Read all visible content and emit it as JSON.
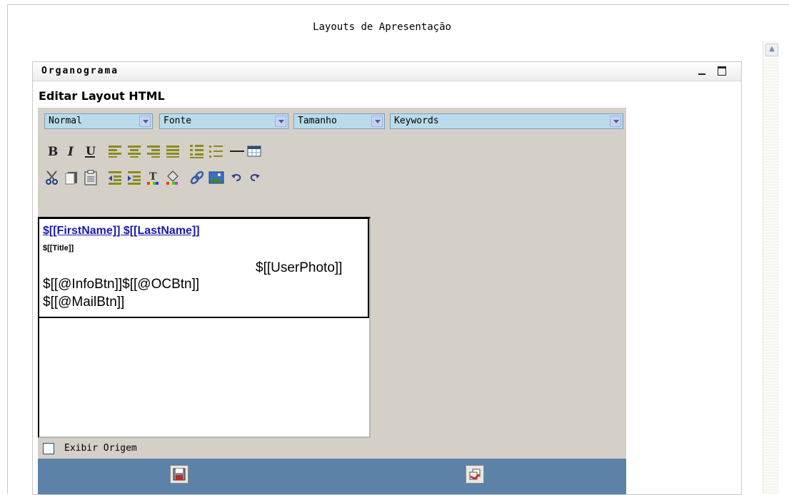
{
  "page": {
    "heading": "Layouts de Apresentação"
  },
  "portlet": {
    "title": "Organograma"
  },
  "editor": {
    "heading": "Editar Layout HTML",
    "selects": {
      "format": "Normal",
      "font": "Fonte",
      "size": "Tamanho",
      "keywords": "Keywords"
    },
    "toolbar_row1": [
      "bold-icon",
      "italic-icon",
      "underline-icon",
      "align-left-icon",
      "align-center-icon",
      "align-right-icon",
      "justify-icon",
      "ordered-list-icon",
      "unordered-list-icon",
      "horizontal-rule-icon",
      "table-icon"
    ],
    "toolbar_row2": [
      "cut-icon",
      "copy-icon",
      "paste-icon",
      "outdent-icon",
      "indent-icon",
      "text-color-icon",
      "background-color-icon",
      "link-icon",
      "image-icon",
      "undo-icon",
      "redo-icon"
    ],
    "canvas": {
      "name_line": "$[[FirstName]] $[[LastName]]",
      "title_line": "$[[Title]]",
      "photo_line": "$[[UserPhoto]]",
      "buttons_line": "$[[@InfoBtn]]$[[@OCBtn]]",
      "mail_line": "$[[@MailBtn]]"
    },
    "show_source": {
      "label": "Exibir Origem",
      "checked": false
    }
  },
  "actions": [
    "save-icon",
    "cancel-icon"
  ],
  "colors": {
    "select_bg": "#b9dcec",
    "panel_bg": "#d4d0c8",
    "action_bar": "#5c82a8",
    "link": "#1a1aa8"
  }
}
